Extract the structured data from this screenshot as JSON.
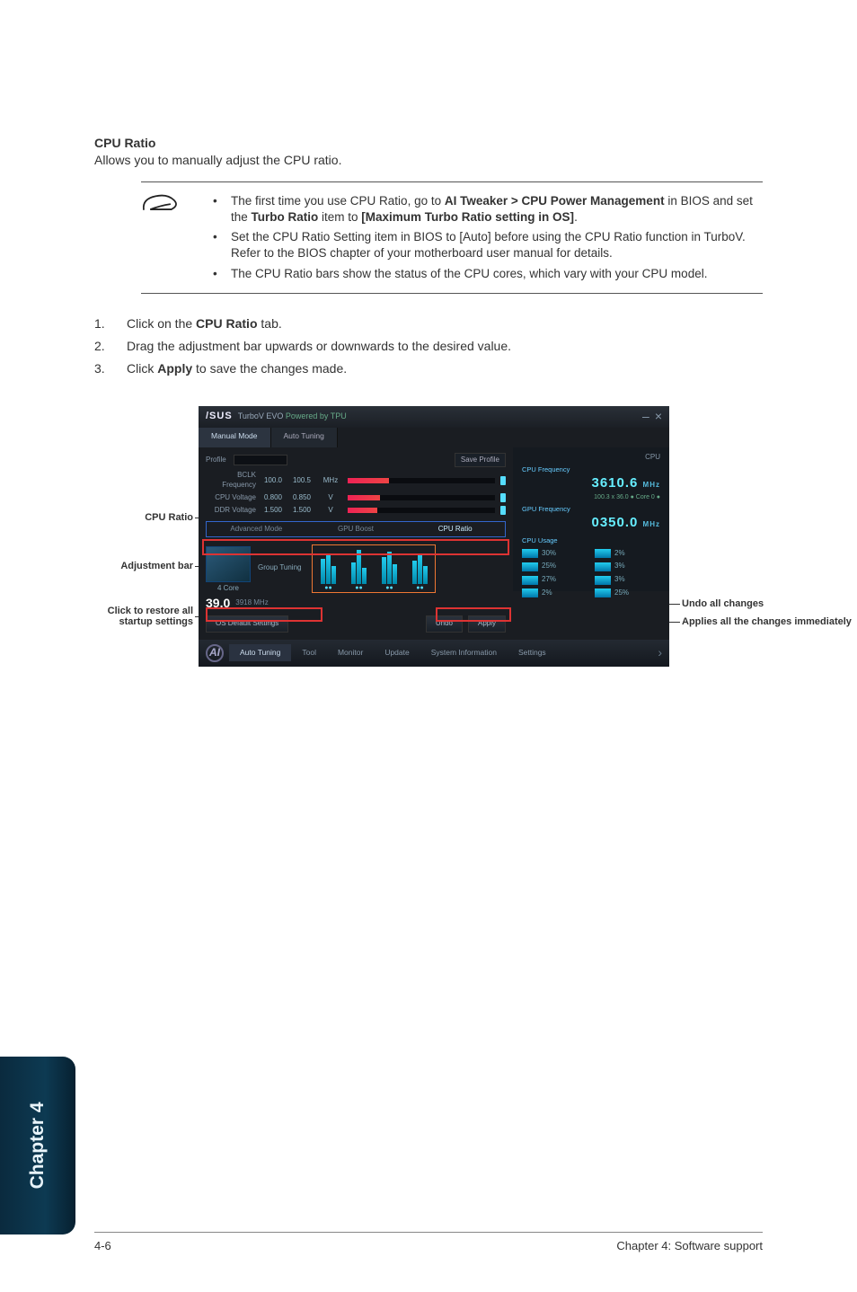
{
  "section": {
    "heading": "CPU Ratio",
    "body": "Allows you to manually adjust the CPU ratio."
  },
  "notes": [
    {
      "pre": "The first time you use CPU Ratio, go to ",
      "b1": "AI Tweaker > CPU Power Management",
      "mid": " in BIOS and set the ",
      "b2": "Turbo Ratio",
      "mid2": " item to ",
      "b3": "[Maximum Turbo Ratio setting in OS]",
      "post": "."
    },
    {
      "plain": "Set the CPU Ratio Setting item in BIOS to [Auto] before using the CPU Ratio function in TurboV. Refer to the BIOS chapter of your motherboard user manual for details."
    },
    {
      "plain": "The CPU Ratio bars show the status of the CPU cores, which vary with your CPU model."
    }
  ],
  "steps": [
    {
      "n": "1.",
      "pre": "Click on the ",
      "b": "CPU Ratio",
      "post": " tab."
    },
    {
      "n": "2.",
      "plain": "Drag the adjustment bar upwards or downwards to the desired value."
    },
    {
      "n": "3.",
      "pre": "Click ",
      "b": "Apply",
      "post": " to save the changes made."
    }
  ],
  "callouts": {
    "cpu_ratio": "CPU Ratio",
    "adj_bar": "Adjustment bar",
    "restore": "Click to restore all startup settings",
    "undo": "Undo all changes",
    "apply": "Applies all the changes immediately"
  },
  "app": {
    "brand": "/SUS",
    "product": "TurboV EVO",
    "powered": "Powered by TPU",
    "win": {
      "min": "–",
      "close": "×"
    },
    "mode_tabs": {
      "manual": "Manual Mode",
      "auto": "Auto Tuning"
    },
    "profile_label": "Profile",
    "save_profile": "Save Profile",
    "sliders": [
      {
        "label": "BCLK Frequency",
        "v1": "100.0",
        "v2": "100.5",
        "unit": "MHz",
        "fill": 28
      },
      {
        "label": "CPU Voltage",
        "v1": "0.800",
        "v2": "0.850",
        "unit": "V",
        "fill": 22
      },
      {
        "label": "DDR Voltage",
        "v1": "1.500",
        "v2": "1.500",
        "unit": "V",
        "fill": 20
      }
    ],
    "sub_tabs": {
      "adv": "Advanced Mode",
      "gpu": "GPU Boost",
      "cpu": "CPU Ratio"
    },
    "chip_label": "4 Core",
    "group_tuning": "Group Tuning",
    "freq_big": "39.0",
    "freq_unit": "3918 MHz",
    "btn_default": "OS Default Settings",
    "btn_undo": "Undo",
    "btn_apply": "Apply",
    "right": {
      "title": "CPU",
      "sec1_label": "CPU Frequency",
      "sec1_value": "3610.6",
      "sec1_unit": "MHz",
      "sec1_sub": "100.3 x 36.0   ●   Core 0   ●",
      "sec2_label": "GPU Frequency",
      "sec2_value": "0350.0",
      "sec2_unit": "MHz",
      "sec3_label": "CPU Usage",
      "usage": [
        "30%",
        "2%",
        "25%",
        "3%",
        "27%",
        "3%",
        "2%",
        "25%"
      ]
    },
    "dock": {
      "items": [
        "Auto Tuning",
        "Tool",
        "Monitor",
        "Update",
        "System Information",
        "Settings"
      ]
    }
  },
  "sidetab": "Chapter 4",
  "footer": {
    "left": "4-6",
    "right": "Chapter 4: Software support"
  }
}
